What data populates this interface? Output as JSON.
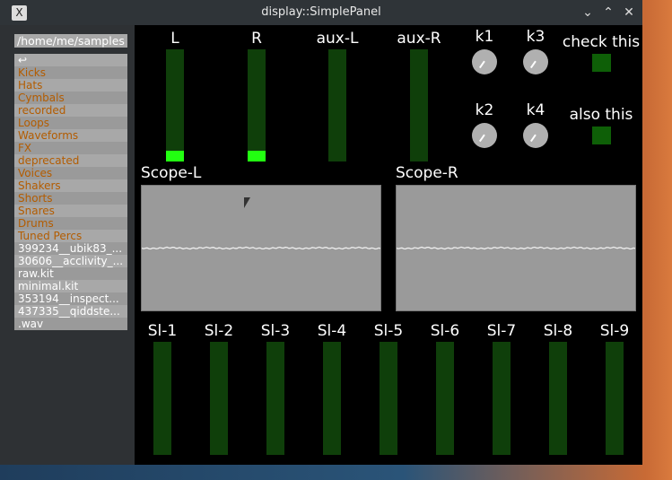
{
  "window": {
    "title": "display::SimplePanel",
    "buttons": [
      "minimize",
      "maximize",
      "close"
    ]
  },
  "browser": {
    "path": "/home/me/samples",
    "items": [
      {
        "label": "↩",
        "type": "up"
      },
      {
        "label": "Kicks",
        "type": "dir"
      },
      {
        "label": "Hats",
        "type": "dir"
      },
      {
        "label": "Cymbals",
        "type": "dir"
      },
      {
        "label": "recorded",
        "type": "dir"
      },
      {
        "label": "Loops",
        "type": "dir"
      },
      {
        "label": "Waveforms",
        "type": "dir"
      },
      {
        "label": "FX",
        "type": "dir"
      },
      {
        "label": "deprecated",
        "type": "dir"
      },
      {
        "label": "Voices",
        "type": "dir"
      },
      {
        "label": "Shakers",
        "type": "dir"
      },
      {
        "label": "Shorts",
        "type": "dir"
      },
      {
        "label": "Snares",
        "type": "dir"
      },
      {
        "label": "Drums",
        "type": "dir"
      },
      {
        "label": "Tuned Percs",
        "type": "dir"
      },
      {
        "label": "399234__ubik83_...",
        "type": "file"
      },
      {
        "label": "30606__acclivity_...",
        "type": "file"
      },
      {
        "label": "raw.kit",
        "type": "file"
      },
      {
        "label": "minimal.kit",
        "type": "file"
      },
      {
        "label": "353194__inspect...",
        "type": "file"
      },
      {
        "label": "437335__qiddste...",
        "type": "file"
      },
      {
        "label": ".wav",
        "type": "file"
      }
    ]
  },
  "meters": [
    {
      "label": "L",
      "level": 0.1
    },
    {
      "label": "R",
      "level": 0.1
    },
    {
      "label": "aux-L",
      "level": 0
    },
    {
      "label": "aux-R",
      "level": 0
    }
  ],
  "knobs": [
    {
      "label": "k1"
    },
    {
      "label": "k3"
    },
    {
      "label": "k2"
    },
    {
      "label": "k4"
    }
  ],
  "checkboxes": [
    {
      "label": "check this"
    },
    {
      "label": "also this"
    }
  ],
  "scopes": [
    {
      "label": "Scope-L"
    },
    {
      "label": "Scope-R"
    }
  ],
  "sliders": [
    {
      "label": "Sl-1"
    },
    {
      "label": "Sl-2"
    },
    {
      "label": "Sl-3"
    },
    {
      "label": "Sl-4"
    },
    {
      "label": "Sl-5"
    },
    {
      "label": "Sl-6"
    },
    {
      "label": "Sl-7"
    },
    {
      "label": "Sl-8"
    },
    {
      "label": "Sl-9"
    }
  ]
}
